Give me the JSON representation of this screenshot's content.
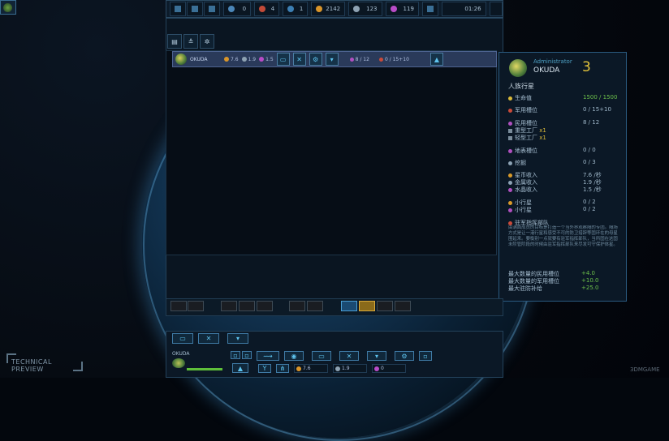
{
  "topbar": {
    "workers": "0",
    "ships": "4",
    "planets": "1",
    "credits": "2142",
    "metal": "123",
    "crystal": "119",
    "timer": "01:26"
  },
  "colony_row": {
    "name": "OKUDA",
    "credit_income": "7.6",
    "metal_income": "1.9",
    "crystal_income": "1.5",
    "civic_slots": "8 / 12",
    "military_slots": "0 / 15+10"
  },
  "info": {
    "owner": "Administrator",
    "planet_name": "OKUDA",
    "level": "3",
    "planet_type": "人族行星",
    "rows": [
      {
        "label": "生命值",
        "value": "1500 / 1500",
        "color": "#d9b93a",
        "value_color": "#6cc04a"
      },
      {
        "label": "军用槽位",
        "value": "0 / 15+10",
        "color": "#c94a3a",
        "value_color": "#9eb6c8"
      },
      {
        "label": "民用槽位",
        "value": "8 / 12",
        "color": "#b050c0",
        "value_color": "#9eb6c8"
      }
    ],
    "factories": [
      {
        "label": "重型工厂",
        "count": "x1"
      },
      {
        "label": "轻型工厂",
        "count": "x1"
      }
    ],
    "surface": {
      "label": "地表槽位",
      "value": "0 / 0"
    },
    "mining": {
      "label": "挖掘",
      "value": "0 / 3"
    },
    "incomes": [
      {
        "label": "星币收入",
        "value": "7.6 /秒",
        "color": "#d99a2a"
      },
      {
        "label": "金属收入",
        "value": "1.9 /秒",
        "color": "#8da3b5"
      },
      {
        "label": "水晶收入",
        "value": "1.5 /秒",
        "color": "#b050c0"
      }
    ],
    "asteroids": [
      {
        "label": "小行星",
        "value": "0 / 2",
        "color": "#d99a2a"
      },
      {
        "label": "小行星",
        "value": "0 / 2",
        "color": "#b050c0"
      }
    ],
    "garrison_title": "驻军指挥部队",
    "garrison_text": "由满面成员的目标是打造一个当外界观察隔的专团。隔场方式是让一港行星和感受不可的防卫措辞等固环在的母星围延来。要衡别一点就要有驻军指挥部队，当所固在这固未阶管阶段的时候由驻军指挥部队来尽发可守保护体星。",
    "bonuses": [
      {
        "label": "最大数量的民用槽位",
        "value": "+4.0"
      },
      {
        "label": "最大数量的军用槽位",
        "value": "+10.0"
      },
      {
        "label": "最大驻防补给",
        "value": "+25.0"
      }
    ]
  },
  "bottom": {
    "planet_name": "OKUDA",
    "credit": "7.6",
    "metal": "1.9",
    "crystal": "0"
  },
  "watermark": {
    "technical_preview": "TECHNICAL PREVIEW",
    "site": "3DMGAME"
  }
}
